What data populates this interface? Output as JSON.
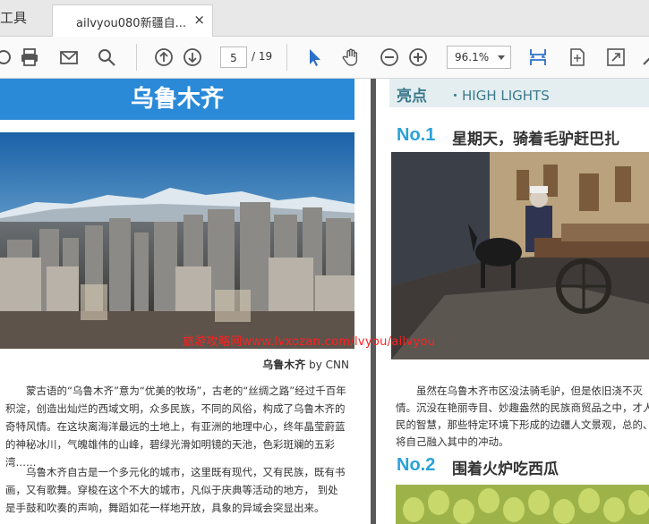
{
  "tabs": {
    "tools_label": "工具",
    "doc_title": "ailvyou080新疆自...",
    "close": "×"
  },
  "toolbar": {
    "page_current": "5",
    "page_total": "/ 19",
    "zoom": "96.1%"
  },
  "left_page": {
    "banner": "乌鲁木齐",
    "credit_name": "乌鲁木齐",
    "credit_by": " by CNN",
    "para1": "蒙古语的“乌鲁木齐”意为“优美的牧场”，古老的“丝绸之路”经过千百年积淀，创造出灿烂的西域文明，众多民族，不同的风俗，构成了乌鲁木齐的奇特风情。在这块离海洋最远的土地上，有亚洲的地理中心，终年晶莹蔚蓝的神秘冰川，气魄雄伟的山峰，碧绿光滑如明镜的天池，色彩斑斓的五彩湾……",
    "para2": "乌鲁木齐自古是一个多元化的城市，这里既有现代，又有民族，既有书画，又有歌舞。穿梭在这个不大的城市，凡似于庆典等活动的地方， 到处是手鼓和吹奏的声响，舞蹈如花一样地开放，具象的异域会突显出来。"
  },
  "right_page": {
    "highlight_cn": "亮点",
    "highlight_en": "・HIGH LIGHTS",
    "no1": "No.1",
    "no1_title": "星期天，骑着毛驴赶巴扎",
    "no1_text": "虽然在乌鲁木齐市区没法骑毛驴，但是依旧浇不灭情。沉没在艳丽寺目、妙趣盎然的民族商贸品之中，才人民的智慧，那些特定环境下形成的边疆人文景观，总的、将自己融入其中的冲动。",
    "no2": "No.2",
    "no2_title": "围着火炉吃西瓜"
  },
  "watermark": "旅游攻略网www.lvxozan.com/lvyou/ailvyou",
  "colors": {
    "banner": "#2a8ad8",
    "number_accent": "#2aa2d8",
    "highlight_bg": "#e4eef0",
    "watermark": "#ff2020"
  }
}
